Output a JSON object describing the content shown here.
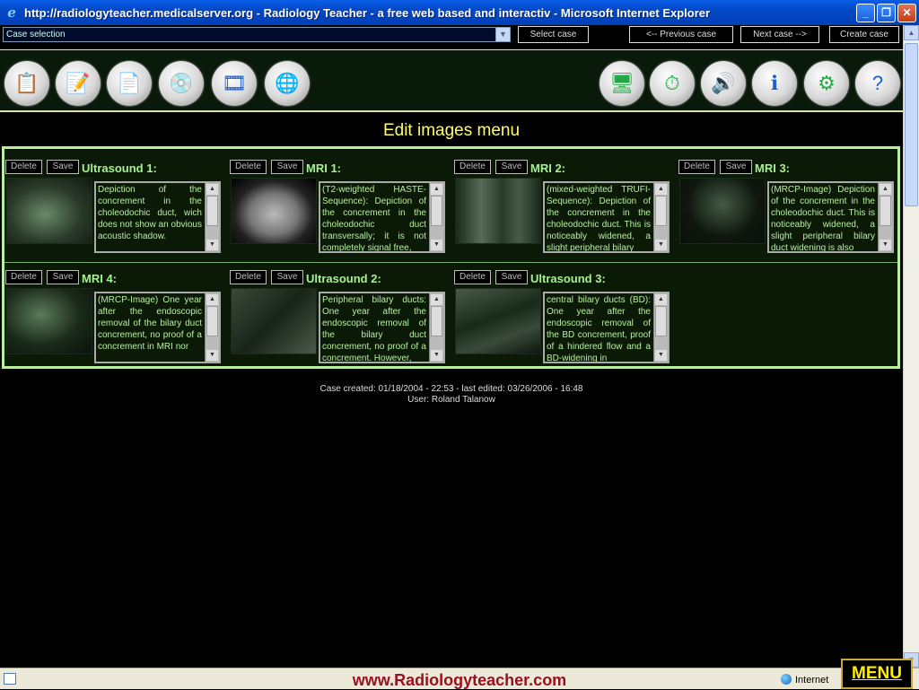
{
  "window": {
    "title": "http://radiologyteacher.medicalserver.org - Radiology Teacher - a free web based and interactiv - Microsoft Internet Explorer"
  },
  "topbar": {
    "case_select": "Case selection",
    "select_case": "Select case",
    "previous_case": "<-- Previous case",
    "next_case": "Next case -->",
    "create_case": "Create case"
  },
  "heading": "Edit images menu",
  "buttons": {
    "delete": "Delete",
    "save": "Save"
  },
  "images": [
    {
      "label": "Ultrasound 1:",
      "text": "Depiction of the concrement in the choleodochic duct,  wich does not show an obvious acoustic shadow."
    },
    {
      "label": "MRI 1:",
      "text": "(T2-weighted HASTE-Sequence):  Depiction of the concrement in the choleodochic duct transversally; it is not completely signal free,"
    },
    {
      "label": "MRI 2:",
      "text": "(mixed-weighted TRUFI-Sequence):  Depiction of the concrement in the choleodochic duct.  This is noticeably widened, a slight peripheral bilary"
    },
    {
      "label": "MRI 3:",
      "text": "(MRCP-Image) Depiction of the concrement in the choleodochic duct.  This is noticeably widened, a slight peripheral bilary duct widening is also"
    },
    {
      "label": "MRI 4:",
      "text": "(MRCP-Image)  One year after the endoscopic removal of the bilary duct concrement,  no proof of a concrement in MRI nor"
    },
    {
      "label": "Ultrasound 2:",
      "text": "Peripheral bilary ducts: One year after the endoscopic removal of the bilary duct concrement, no proof of a concrement.  However,"
    },
    {
      "label": "Ultrasound 3:",
      "text": "central  bilary ducts (BD): One year after the endoscopic removal of the BD concrement, proof of a hindered flow and a BD-widening in"
    }
  ],
  "footer": {
    "created": "Case created: 01/18/2004 - 22:53 - last edited: 03/26/2006 - 16:48",
    "user": "User: Roland Talanow"
  },
  "statusbar": {
    "url": "www.Radiologyteacher.com",
    "zone": "Internet"
  },
  "menu": "MENU"
}
